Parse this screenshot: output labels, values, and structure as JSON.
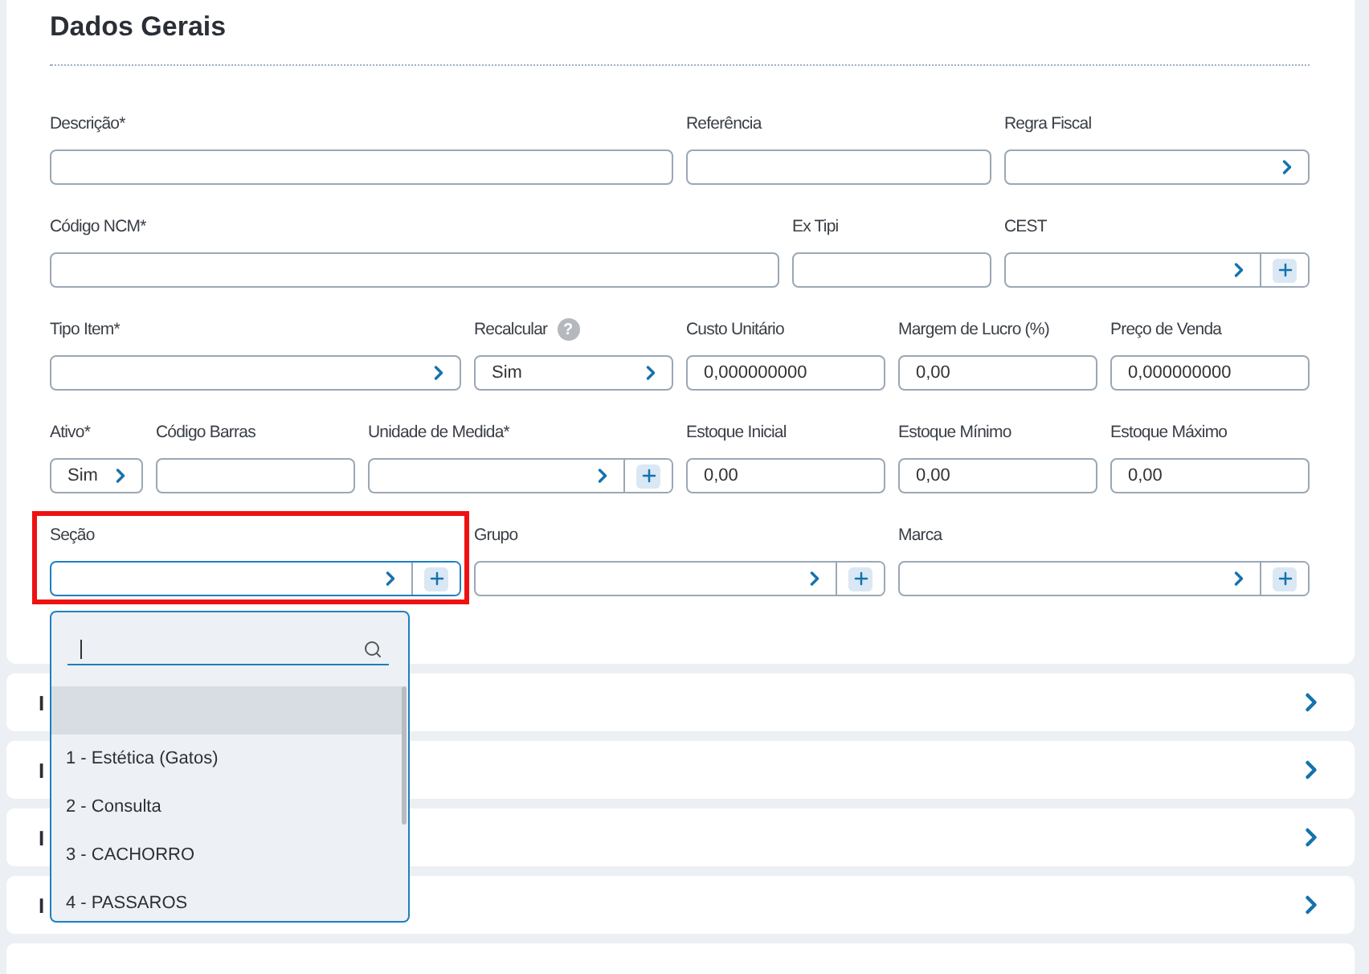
{
  "title": "Dados Gerais",
  "rows": [
    {
      "fields": [
        {
          "label": "Descrição*",
          "kind": "text"
        },
        {
          "label": "Referência",
          "kind": "text"
        },
        {
          "label": "Regra Fiscal",
          "kind": "select"
        }
      ]
    },
    {
      "fields": [
        {
          "label": "Código NCM*",
          "kind": "text"
        },
        {
          "label": "Ex Tipi",
          "kind": "text"
        },
        {
          "label": "CEST",
          "kind": "select_add"
        }
      ]
    },
    {
      "fields": [
        {
          "label": "Tipo Item*",
          "kind": "select"
        },
        {
          "label": "Recalcular",
          "kind": "select",
          "help": "?",
          "value": "Sim"
        },
        {
          "label": "Custo Unitário",
          "kind": "text",
          "value": "0,000000000"
        },
        {
          "label": "Margem de Lucro (%)",
          "kind": "text",
          "value": "0,00"
        },
        {
          "label": "Preço de Venda",
          "kind": "text",
          "value": "0,000000000"
        }
      ]
    },
    {
      "fields": [
        {
          "label": "Ativo*",
          "kind": "select",
          "value": "Sim"
        },
        {
          "label": "Código Barras",
          "kind": "text"
        },
        {
          "label": "Unidade de Medida*",
          "kind": "select_add"
        },
        {
          "label": "Estoque Inicial",
          "kind": "text",
          "value": "0,00"
        },
        {
          "label": "Estoque Mínimo",
          "kind": "text",
          "value": "0,00"
        },
        {
          "label": "Estoque Máximo",
          "kind": "text",
          "value": "0,00"
        }
      ]
    },
    {
      "fields": [
        {
          "label": "Seção",
          "kind": "select_add",
          "highlighted": true,
          "focused": true,
          "dropdown": {
            "options": [
              {
                "selected": true
              },
              {
                "label": "1 - Estética (Gatos)",
                "selected": false
              },
              {
                "label": "2 - Consulta",
                "selected": false
              },
              {
                "label": "3 - CACHORRO",
                "selected": false
              },
              {
                "label": "4 - PASSAROS",
                "selected": false
              }
            ]
          }
        },
        {
          "label": "Grupo",
          "kind": "select_add",
          "focused": false
        },
        {
          "label": "Marca",
          "kind": "select_add",
          "focused": false
        }
      ]
    }
  ],
  "sections": [
    {
      "label": "I"
    },
    {
      "label": "I"
    },
    {
      "label": "I"
    },
    {
      "label": "I"
    }
  ]
}
